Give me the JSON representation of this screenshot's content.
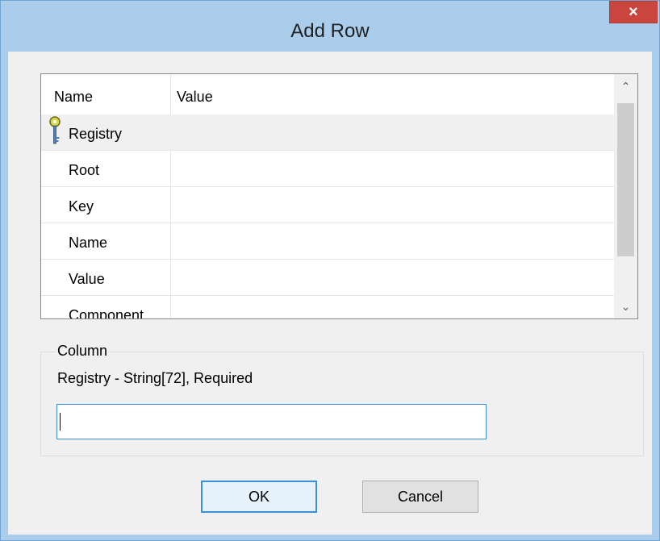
{
  "window": {
    "title": "Add Row",
    "close_glyph": "×"
  },
  "grid": {
    "columns": [
      "Name",
      "Value"
    ],
    "rows": [
      {
        "name": "Registry",
        "value": "",
        "icon": "key-icon",
        "selected": true
      },
      {
        "name": "Root",
        "value": ""
      },
      {
        "name": "Key",
        "value": ""
      },
      {
        "name": "Name",
        "value": ""
      },
      {
        "name": "Value",
        "value": ""
      },
      {
        "name": "Component_",
        "value": ""
      }
    ],
    "scroll_up_glyph": "⌃",
    "scroll_down_glyph": "⌄"
  },
  "column_group": {
    "legend": "Column",
    "description": "Registry - String[72], Required",
    "input_value": ""
  },
  "buttons": {
    "ok_label": "OK",
    "cancel_label": "Cancel"
  },
  "colors": {
    "title_bar": "#a9cdea",
    "close_button": "#c9453d",
    "focus_border": "#3c8fd6"
  }
}
